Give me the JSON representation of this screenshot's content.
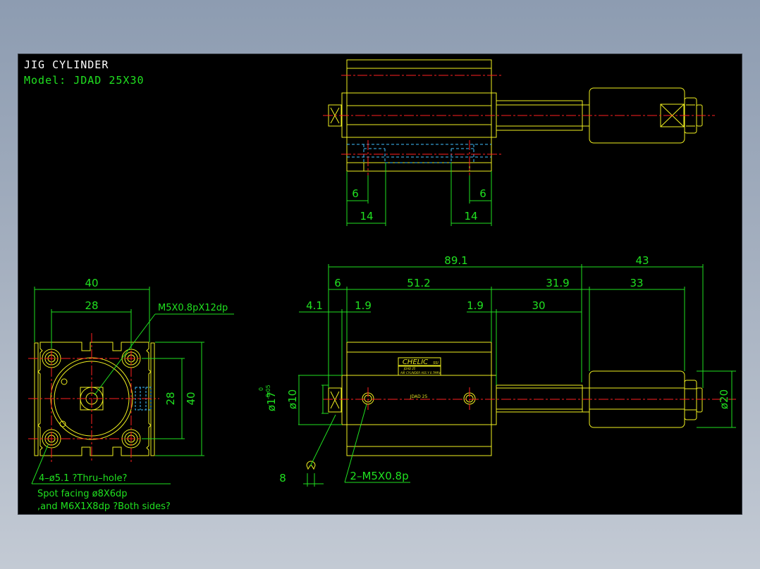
{
  "header": {
    "title": "JIG CYLINDER",
    "model": "Model:  JDAD 25X30"
  },
  "colors": {
    "background": "#000000",
    "outline": "#f0f020",
    "dimension": "#20e020",
    "centerline": "#ff2020",
    "hidden": "#40c0ff",
    "label": "#e0e020"
  },
  "top_view": {
    "dims": {
      "d6_left": "6",
      "d14_left": "14",
      "d6_right": "6",
      "d14_right": "14"
    }
  },
  "front_view": {
    "dims": {
      "d89": "89.1",
      "d43": "43",
      "d6": "6",
      "d51": "51.2",
      "d31": "31.9",
      "d33": "33",
      "d4": "4.1",
      "d19a": "1.9",
      "d19b": "1.9",
      "d30": "30",
      "d20": "ø20",
      "d17": "ø17",
      "d17tol_top": "0",
      "d17tol_bot": "-0.05",
      "d10": "ø10",
      "d8": "8",
      "port": "2–M5X0.8p"
    },
    "label_brand": "CHELIC",
    "label_brand_suffix": "SSI",
    "label_line1": "JDAD 25",
    "label_line2": "AIR CYLINDER   ASS.Y 0.7MPa",
    "body_text": "JDAD 25"
  },
  "side_view": {
    "dims": {
      "d40_top": "40",
      "d28_top": "28",
      "d28_right": "28",
      "d40_right": "40"
    },
    "thread_note": "M5X0.8pX12dp",
    "hole_note_1": "4–ø5.1 ?Thru–hole?",
    "hole_note_2": "Spot facing  ø8X6dp",
    "hole_note_3": ",and  M6X1X8dp ?Both sides?"
  }
}
